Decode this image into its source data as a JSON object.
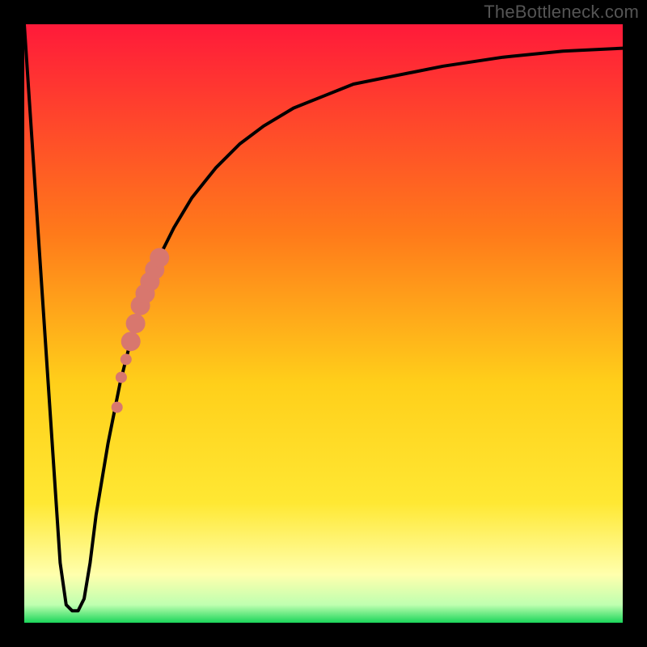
{
  "watermark": "TheBottleneck.com",
  "colors": {
    "frame": "#000000",
    "line": "#000000",
    "dots": "#d8776e",
    "gradient_top": "#ff1a3a",
    "gradient_orange": "#ff8a1a",
    "gradient_yellow": "#ffe833",
    "gradient_paleyellow": "#ffffad",
    "gradient_green": "#1bd65a"
  },
  "chart_data": {
    "type": "line",
    "title": "",
    "xlabel": "",
    "ylabel": "",
    "xlim": [
      0,
      100
    ],
    "ylim": [
      0,
      100
    ],
    "series": [
      {
        "name": "bottleneck_curve",
        "x": [
          0,
          2,
          4,
          6,
          7,
          8,
          9,
          10,
          11,
          12,
          14,
          16,
          18,
          20,
          22,
          25,
          28,
          32,
          36,
          40,
          45,
          50,
          55,
          60,
          70,
          80,
          90,
          100
        ],
        "y": [
          100,
          70,
          40,
          10,
          3,
          2,
          2,
          4,
          10,
          18,
          30,
          40,
          48,
          55,
          60,
          66,
          71,
          76,
          80,
          83,
          86,
          88,
          90,
          91,
          93,
          94.5,
          95.5,
          96
        ]
      }
    ],
    "dots": {
      "name": "highlighted_points",
      "x": [
        15.5,
        16.2,
        17.0,
        17.8,
        18.6,
        19.4,
        20.2,
        21.0,
        21.8,
        22.6
      ],
      "y": [
        36,
        41,
        44,
        47,
        50,
        53,
        55,
        57,
        59,
        61
      ]
    }
  }
}
